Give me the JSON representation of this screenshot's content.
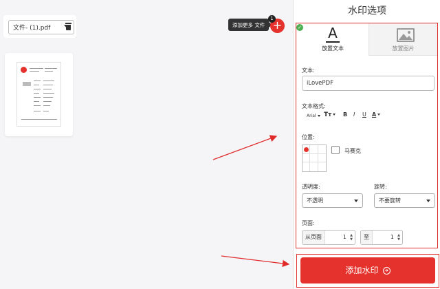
{
  "file_bar": {
    "file_name": "文件- (1).pdf"
  },
  "add_files": {
    "tooltip": "添加更多 文件",
    "badge_count": "1",
    "plus": "+"
  },
  "panel": {
    "title": "水印选项",
    "tabs": [
      {
        "label": "放置文本",
        "icon": "text-a-icon",
        "selected": true
      },
      {
        "label": "放置图片",
        "icon": "image-icon",
        "selected": false
      }
    ],
    "text_label": "文本:",
    "text_value": "iLovePDF",
    "format_label": "文本格式:",
    "format": {
      "font": "Arial",
      "size": "Tт",
      "bold": "B",
      "italic": "I",
      "underline": "U",
      "color": "A"
    },
    "position_label": "位置:",
    "mosaic_label": "马赛克",
    "transparency_label": "透明度:",
    "transparency_value": "不透明",
    "rotation_label": "旋转:",
    "rotation_value": "不要旋转",
    "pages_label": "页面:",
    "from_label": "从页面",
    "from_value": "1",
    "to_label": "至",
    "to_value": "1",
    "submit_label": "添加水印",
    "submit_icon": "arrow-circle-icon"
  },
  "colors": {
    "accent": "#e5322d",
    "highlight": "#e12b2b",
    "check": "#4caf50"
  }
}
